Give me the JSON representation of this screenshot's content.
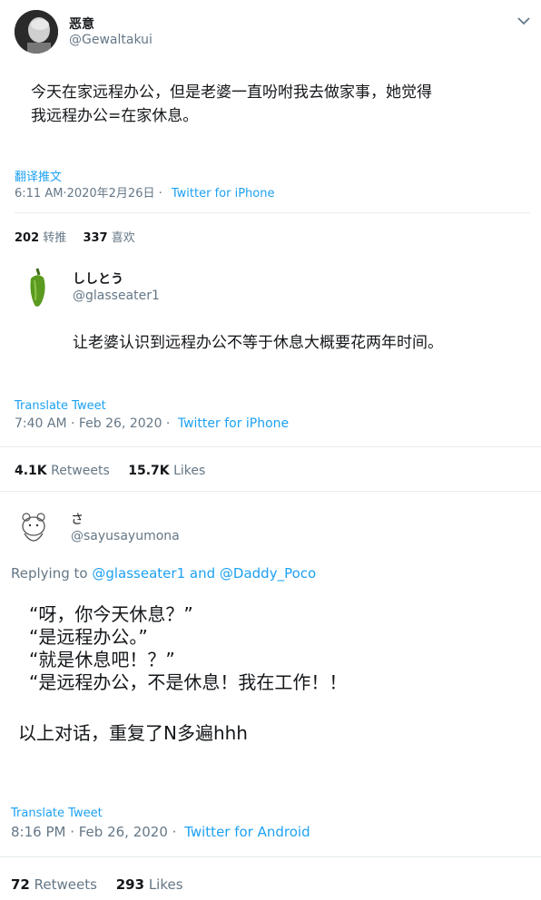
{
  "tweet1": {
    "name": "恶意",
    "handle": "@Gewaltakui",
    "text_line1": "今天在家远程办公，但是老婆一直吩咐我去做家事，她觉得",
    "text_line2": "我远程办公=在家休息。",
    "translate": "翻译推文",
    "time": "6:11 AM·2020年2月26日 ·",
    "source": "Twitter for iPhone",
    "retweets_count": "202",
    "retweets_label": "转推",
    "likes_count": "337",
    "likes_label": "喜欢"
  },
  "tweet2": {
    "name": "ししとう",
    "handle": "@glasseater1",
    "text": "让老婆认识到远程办公不等于休息大概要花两年时间。",
    "translate": "Translate Tweet",
    "time": "7:40 AM · Feb 26, 2020 ·",
    "source": "Twitter for iPhone",
    "retweets_count": "4.1K",
    "retweets_label": "Retweets",
    "likes_count": "15.7K",
    "likes_label": "Likes"
  },
  "tweet3": {
    "name": "さ",
    "handle": "@sayusayumona",
    "replying_prefix": "Replying to",
    "reply_to_1": "@glasseater1",
    "reply_and": "and",
    "reply_to_2": "@Daddy_Poco",
    "line1": "“呀，你今天休息？”",
    "line2": "“是远程办公。”",
    "line3": "“就是休息吧！？”",
    "line4": "“是远程办公，不是休息！我在工作！！",
    "line5": "以上对话，重复了N多遍hhh",
    "translate": "Translate Tweet",
    "time": "8:16 PM · Feb 26, 2020 ·",
    "source": "Twitter for Android",
    "retweets_count": "72",
    "retweets_label": "Retweets",
    "likes_count": "293",
    "likes_label": "Likes"
  },
  "icons": {
    "menu": "chevron-down-icon",
    "avatar1": "person-photo",
    "avatar2": "green-pepper",
    "avatar3": "bear-sketch"
  },
  "colors": {
    "link": "#1da1f2",
    "muted": "#657786",
    "text": "#14171a"
  }
}
